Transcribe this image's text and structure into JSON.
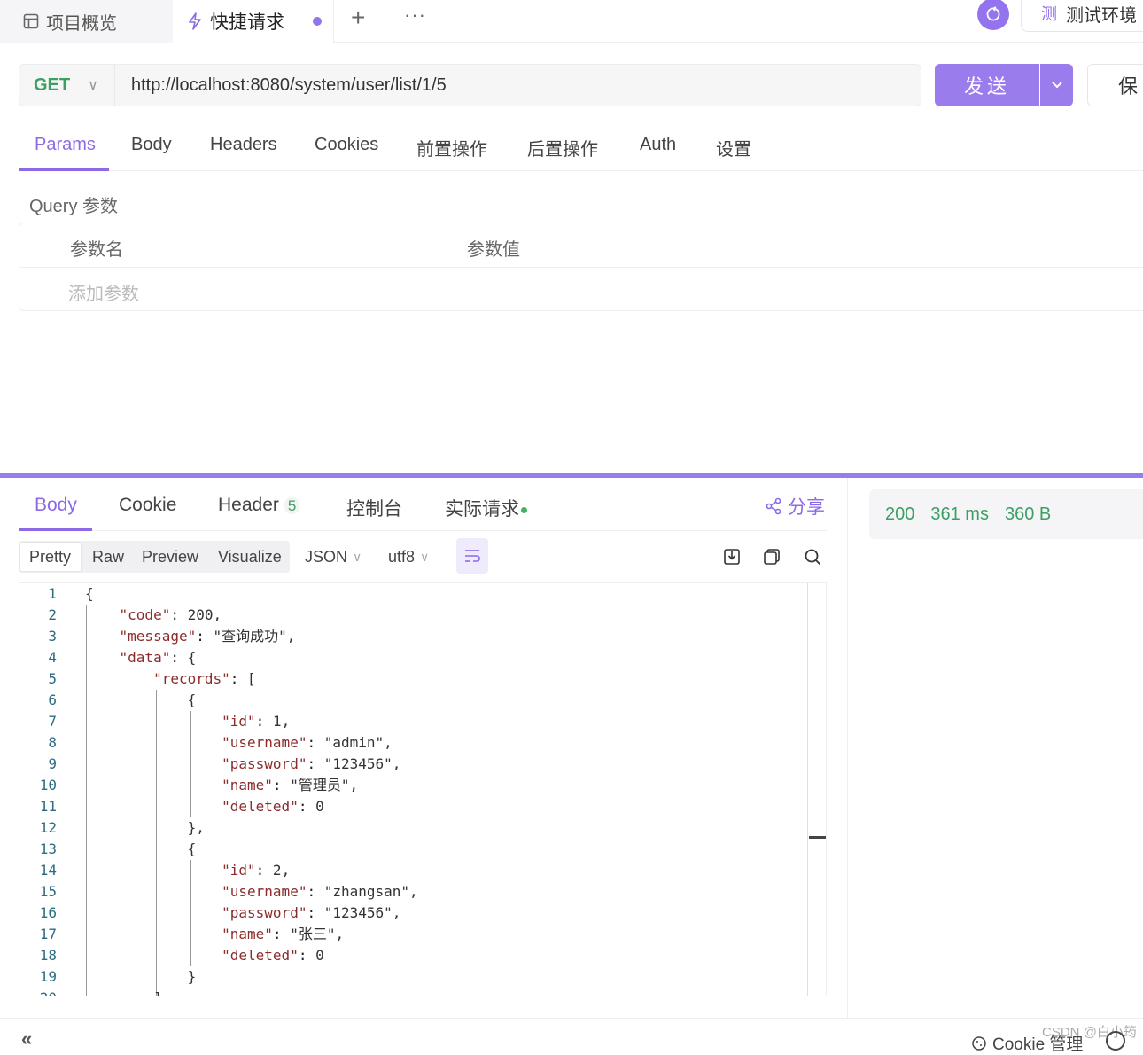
{
  "tabs": {
    "overview_label": "项目概览",
    "quick_label": "快捷请求",
    "add_icon": "+",
    "more_icon": "···"
  },
  "env": {
    "badge": "测",
    "label": "测试环境"
  },
  "request": {
    "method": "GET",
    "url": "http://localhost:8080/system/user/list/1/5",
    "send_label": "发送",
    "save_label": "保"
  },
  "req_tabs": [
    "Params",
    "Body",
    "Headers",
    "Cookies",
    "前置操作",
    "后置操作",
    "Auth",
    "设置"
  ],
  "params": {
    "title": "Query 参数",
    "col_name": "参数名",
    "col_value": "参数值",
    "add_placeholder": "添加参数"
  },
  "resp_tabs": {
    "body": "Body",
    "cookie": "Cookie",
    "header": "Header",
    "header_count": "5",
    "console": "控制台",
    "actual": "实际请求",
    "share": "分享"
  },
  "view": {
    "modes": [
      "Pretty",
      "Raw",
      "Preview",
      "Visualize"
    ],
    "format": "JSON",
    "encoding": "utf8"
  },
  "status": {
    "code": "200",
    "time": "361 ms",
    "size": "360 B"
  },
  "code_lines": [
    "{",
    "    \"code\": 200,",
    "    \"message\": \"查询成功\",",
    "    \"data\": {",
    "        \"records\": [",
    "            {",
    "                \"id\": 1,",
    "                \"username\": \"admin\",",
    "                \"password\": \"123456\",",
    "                \"name\": \"管理员\",",
    "                \"deleted\": 0",
    "            },",
    "            {",
    "                \"id\": 2,",
    "                \"username\": \"zhangsan\",",
    "                \"password\": \"123456\",",
    "                \"name\": \"张三\",",
    "                \"deleted\": 0",
    "            }",
    "        ]"
  ],
  "footer": {
    "collapse_icon": "«",
    "cookie_mgr": "Cookie 管理",
    "watermark": "CSDN @白小筠"
  },
  "colors": {
    "accent": "#9a7cec",
    "method_green": "#3d9f64"
  }
}
